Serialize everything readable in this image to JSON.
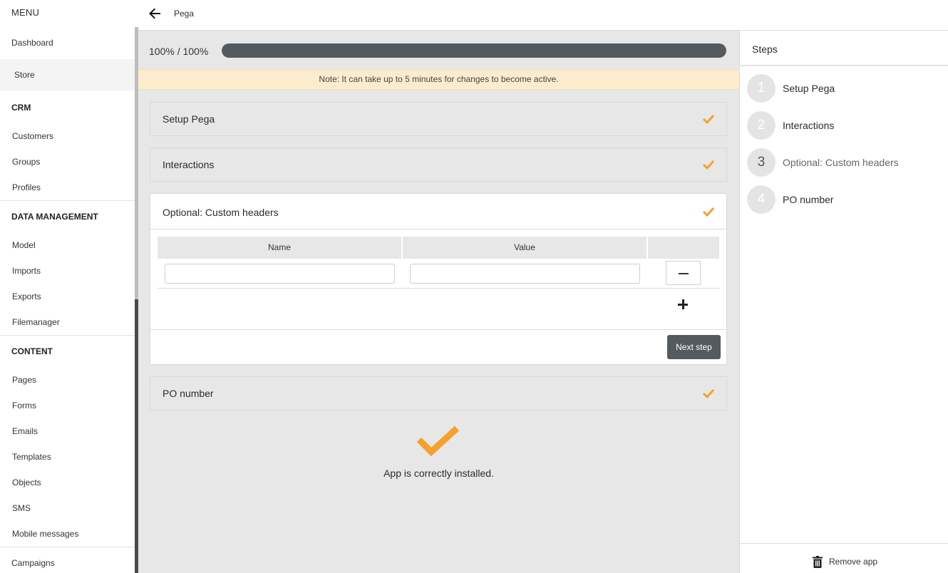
{
  "sidebar": {
    "menu_title": "MENU",
    "top_links": [
      {
        "label": "Dashboard",
        "active": false
      },
      {
        "label": "Store",
        "active": true
      }
    ],
    "sections": [
      {
        "heading": "CRM",
        "items": [
          "Customers",
          "Groups",
          "Profiles"
        ]
      },
      {
        "heading": "DATA MANAGEMENT",
        "items": [
          "Model",
          "Imports",
          "Exports",
          "Filemanager"
        ]
      },
      {
        "heading": "CONTENT",
        "items": [
          "Pages",
          "Forms",
          "Emails",
          "Templates",
          "Objects",
          "SMS",
          "Mobile messages"
        ]
      }
    ],
    "bottom_link": "Campaigns"
  },
  "header": {
    "back_icon": "arrow-left-icon",
    "title": "Pega"
  },
  "main": {
    "progress_label": "100% / 100%",
    "progress_fraction": 1.0,
    "note": "Note: It can take up to 5 minutes for changes to become active.",
    "steps": [
      {
        "label": "Setup Pega",
        "complete": true
      },
      {
        "label": "Interactions",
        "complete": true
      },
      {
        "label": "Optional: Custom headers",
        "complete": true,
        "expanded": true
      },
      {
        "label": "PO number",
        "complete": true
      }
    ],
    "headers_table": {
      "columns": [
        "Name",
        "Value"
      ],
      "rows": [
        {
          "name": "",
          "value": ""
        }
      ]
    },
    "next_step_label": "Next step",
    "success_text": "App is correctly installed.",
    "accent_color": "#f6a02d"
  },
  "steps_panel": {
    "title": "Steps",
    "items": [
      {
        "number": "1",
        "label": "Setup Pega"
      },
      {
        "number": "2",
        "label": "Interactions"
      },
      {
        "number": "3",
        "label": "Optional: Custom headers",
        "current": true
      },
      {
        "number": "4",
        "label": "PO number"
      }
    ],
    "remove_app_label": "Remove app",
    "remove_icon": "trash-icon"
  }
}
